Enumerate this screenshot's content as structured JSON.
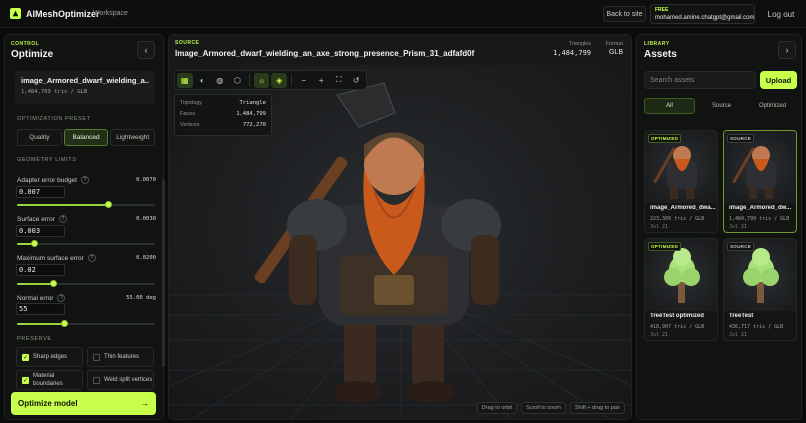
{
  "app": {
    "name": "AIMeshOptimizer",
    "section": "Workspace",
    "back_label": "Back to site",
    "user_plan": "FREE",
    "user_email": "mohamed.amine.chatgpt@gmail.com",
    "logout_label": "Log out",
    "accent": "#c8ff4a"
  },
  "left": {
    "eyebrow": "CONTROL",
    "title": "Optimize",
    "collapse_icon": "chevron-left-icon",
    "model_name": "image_Armored_dwarf_wielding_a...",
    "model_meta": "1,484,799 tris / GLB",
    "preset_label": "OPTIMIZATION PRESET",
    "presets": [
      "Quality",
      "Balanced",
      "Lightweight"
    ],
    "active_preset": "Balanced",
    "limits_label": "GEOMETRY LIMITS",
    "fields": [
      {
        "label": "Adapter error budget",
        "display": "0.0070",
        "input": "0.007",
        "level": 0.66
      },
      {
        "label": "Surface error",
        "display": "0.0030",
        "input": "0.003",
        "level": 0.12
      },
      {
        "label": "Maximum surface error",
        "display": "0.0200",
        "input": "0.02",
        "level": 0.26
      },
      {
        "label": "Normal error",
        "display": "55.00 deg",
        "input": "55",
        "level": 0.34
      }
    ],
    "preserve_label": "PRESERVE",
    "options": [
      {
        "label": "Sharp edges",
        "checked": true
      },
      {
        "label": "Thin features",
        "checked": false
      },
      {
        "label": "Material boundaries",
        "checked": true
      },
      {
        "label": "Weld split vertices",
        "checked": false
      }
    ],
    "primary_label": "Optimize model",
    "primary_arrow": "→"
  },
  "center": {
    "eyebrow": "SOURCE",
    "title": "Image_Armored_dwarf_wielding_an_axe_strong_presence_Prism_31_adfafd0f",
    "stat_triangles_label": "Triangles",
    "stat_triangles_value": "1,484,799",
    "stat_format_label": "Format",
    "stat_format_value": "GLB",
    "toolbar_icons": [
      "grid-icon",
      "half-circle-icon",
      "globe-icon",
      "cube-icon",
      "sun-icon",
      "layers-icon",
      "zoom-out-icon",
      "zoom-in-icon",
      "fit-icon",
      "reset-icon"
    ],
    "info": [
      {
        "k": "Topology",
        "v": "Triangle"
      },
      {
        "k": "Faces",
        "v": "1,484,799"
      },
      {
        "k": "Vertices",
        "v": "772,270"
      }
    ],
    "hints": [
      "Drag to orbit",
      "Scroll to zoom",
      "Shift + drag to pan"
    ]
  },
  "right": {
    "eyebrow": "LIBRARY",
    "title": "Assets",
    "expand_icon": "chevron-right-icon",
    "search_placeholder": "Search assets",
    "upload_label": "Upload",
    "filters": [
      "All",
      "Source",
      "Optimized"
    ],
    "active_filter": "All",
    "cards": [
      {
        "tag": "OPTIMIZED",
        "name": "image_Armored_dwa...",
        "meta": "223,309 tris / GLB",
        "date": "Jul 21",
        "kind": "dwarf"
      },
      {
        "tag": "SOURCE",
        "name": "image_Armored_dw...",
        "meta": "1,484,799 tris / GLB",
        "date": "Jul 21",
        "kind": "dwarf"
      },
      {
        "tag": "OPTIMIZED",
        "name": "TreeTest optimized",
        "meta": "418,907 tris / GLB",
        "date": "Jul 21",
        "kind": "tree"
      },
      {
        "tag": "SOURCE",
        "name": "TreeTest",
        "meta": "436,717 tris / GLB",
        "date": "Jul 21",
        "kind": "tree"
      }
    ]
  }
}
